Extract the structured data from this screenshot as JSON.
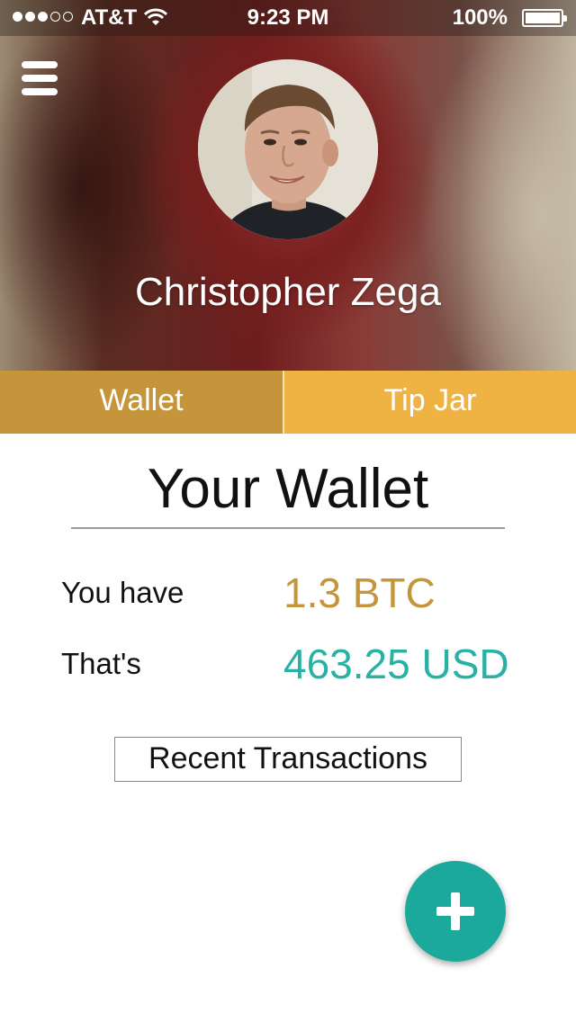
{
  "status_bar": {
    "carrier": "AT&T",
    "time": "9:23 PM",
    "battery": "100%",
    "signal_bars_filled": 3,
    "signal_bars_total": 5
  },
  "profile": {
    "name": "Christopher Zega"
  },
  "tabs": [
    {
      "label": "Wallet",
      "active": true
    },
    {
      "label": "Tip Jar",
      "active": false
    }
  ],
  "wallet": {
    "title": "Your Wallet",
    "btc_label": "You have",
    "btc_value": "1.3 BTC",
    "usd_label": "That's",
    "usd_value": "463.25 USD",
    "recent_button": "Recent Transactions"
  },
  "colors": {
    "gold_active": "#c4953a",
    "gold_light": "#efb344",
    "teal": "#1aa99a",
    "usd_text": "#29b1a4"
  },
  "icons": {
    "menu": "hamburger-icon",
    "fab": "plus-icon",
    "wifi": "wifi-icon",
    "battery": "battery-icon"
  }
}
